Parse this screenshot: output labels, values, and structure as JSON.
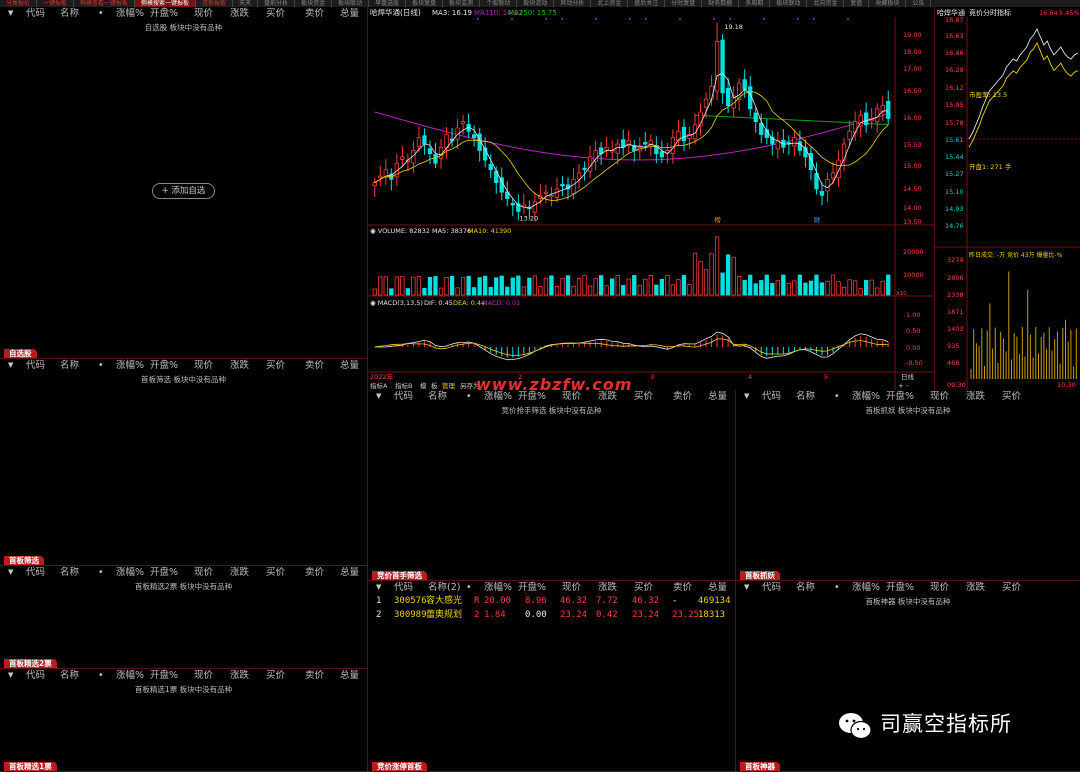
{
  "tabs": [
    "分类报价",
    "一键报板",
    "侧模查看一键报板",
    "侧模搜索一键报板",
    "连板报板",
    "天天",
    "盘前分析",
    "板块资金",
    "板块联动",
    "早盘选股",
    "板块复盘",
    "板块监测",
    "个股联动",
    "板块流动",
    "异动分析",
    "北上资金",
    "盘后关注",
    "分时复盘",
    "财务数据",
    "多周期",
    "板块联动",
    "北向资金",
    "复盘",
    "收藏板块",
    "公告"
  ],
  "col_headers_a": [
    "代码",
    "名称",
    "•",
    "涨幅%",
    "开盘%",
    "现价",
    "涨跌",
    "买价",
    "卖价",
    "总量"
  ],
  "col_headers_b": [
    "代码",
    "名称(2)",
    "•",
    "涨幅%",
    "开盘%",
    "现价",
    "涨跌",
    "买价",
    "卖价",
    "总量"
  ],
  "col_headers_c": [
    "代码",
    "名称",
    "•",
    "涨幅%",
    "开盘%",
    "现价",
    "涨跌",
    "买价"
  ],
  "left_panels": [
    {
      "tab": "自选股",
      "empty_msg": "自选股 板块中没有品种",
      "add_button": "添加自选"
    },
    {
      "tab": "首板筛选",
      "empty_msg": "首板筛选 板块中没有品种"
    },
    {
      "tab": "首板精选2票",
      "empty_msg": "首板精选2票 板块中没有品种"
    },
    {
      "tab": "首板精选1票",
      "empty_msg": "首板精选1票 板块中没有品种"
    }
  ],
  "mid_panels": [
    {
      "tab": "竞价首手筛选",
      "empty_msg": "竞价抢手筛选 板块中没有品种"
    },
    {
      "tab": "竞价涨停首板",
      "empty_msg": ""
    }
  ],
  "right_panels": [
    {
      "tab": "首板抓妖",
      "empty_msg": "首板抓妖 板块中没有品种"
    },
    {
      "tab": "首板神器",
      "empty_msg": "首板神器 板块中没有品种"
    }
  ],
  "stock_rows": [
    {
      "idx": "1",
      "code": "300576",
      "name": "容大感光",
      "tag": "R",
      "chg": "20.00",
      "open": "0.96",
      "price": "46.32",
      "diff": "7.72",
      "bid": "46.32",
      "ask": "-",
      "vol": "469134"
    },
    {
      "idx": "2",
      "code": "300989",
      "name": "蕾奥规划",
      "tag": "2",
      "chg": "1.84",
      "open": "0.00",
      "price": "23.24",
      "diff": "0.42",
      "bid": "23.24",
      "ask": "23.25",
      "vol": "18313"
    }
  ],
  "kline": {
    "title": "哈焊华通(日线)",
    "ma3": "MA3: 16.19",
    "ma110": "MA110: 14.92",
    "ma250": "MA250: 15.75",
    "peak": "19.18",
    "trough": "13.20",
    "yticks": [
      "19.00",
      "18.00",
      "17.00",
      "16.50",
      "16.00",
      "15.50",
      "15.00",
      "14.50",
      "14.00",
      "13.50"
    ],
    "vol_label": "VOLUME: 82832",
    "vol_ma5": "MA5: 38376",
    "vol_ma10": "MA10: 41390",
    "vol_ticks": [
      "20000",
      "10000"
    ],
    "vol_unit": "X10",
    "macd_label": "MACD(3,13,5)",
    "dif": "DIF: 0.45",
    "dea": "DEA: 0.44",
    "macd": "MACD: 0.02",
    "macd_ticks": [
      "1.00",
      "0.50",
      "0.00",
      "-0.50"
    ],
    "dates": [
      "2022年",
      "2",
      "3",
      "4",
      "5"
    ],
    "mark1": "榜",
    "mark2": "财",
    "period": "日线",
    "bottom_tabs": [
      "指标A",
      "指标B",
      "模",
      "板",
      "管理",
      "另存为"
    ]
  },
  "intraday": {
    "title": "哈焊华通",
    "subtitle": "竞价分时指标",
    "price_lbl": "16.64",
    "pct_lbl": "5.45%",
    "yticks": [
      "16.87",
      "16.63",
      "16.46",
      "16.29",
      "16.12",
      "15.95",
      "15.78",
      "15.61",
      "15.44",
      "15.27",
      "15.10",
      "14.93",
      "14.76"
    ],
    "pe_label": "市盈率: 13.5",
    "open_label": "开盘1: 271 手",
    "vol_label": "昨日成交: -万 竞价 43万 爆量比-%",
    "vol_ticks": [
      "3274",
      "2806",
      "2338",
      "1871",
      "1403",
      "935",
      "468"
    ],
    "times": [
      "09:30",
      "10:30"
    ]
  },
  "watermark": {
    "site": "www.zbzfw.com",
    "brand": "司赢空指标所"
  },
  "colors": {
    "up": "#ff3a3a",
    "down": "#00e0e0",
    "ma_white": "#e8e8e8",
    "ma_yellow": "#f0d000",
    "ma_purple": "#c020c0",
    "ma_green": "#10a010"
  }
}
